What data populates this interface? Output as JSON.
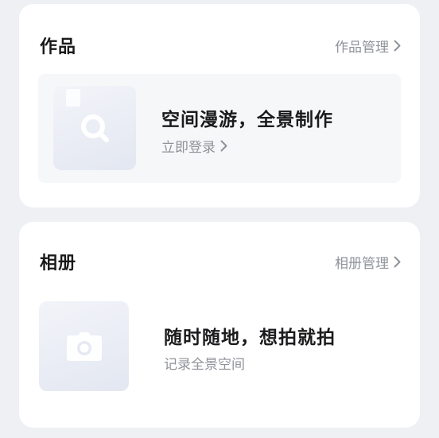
{
  "works": {
    "title": "作品",
    "manage_label": "作品管理",
    "promo_title": "空间漫游，全景制作",
    "promo_action": "立即登录"
  },
  "album": {
    "title": "相册",
    "manage_label": "相册管理",
    "promo_title": "随时随地，想拍就拍",
    "promo_subtitle": "记录全景空间"
  },
  "icons": {
    "chevron": "chevron-right-icon",
    "works_thumb": "file-search-icon",
    "album_thumb": "camera-icon"
  }
}
